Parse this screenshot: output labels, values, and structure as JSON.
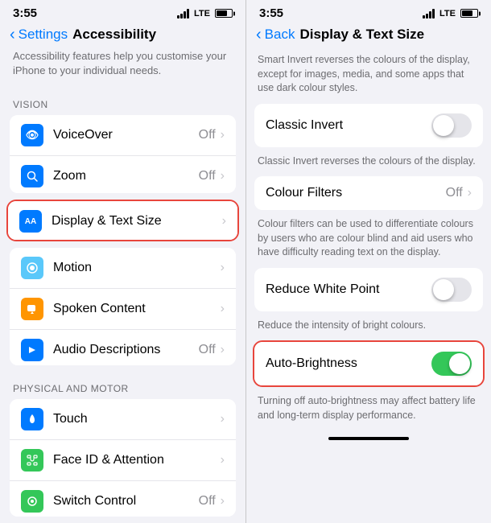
{
  "left": {
    "statusBar": {
      "time": "3:55",
      "lte": "LTE"
    },
    "nav": {
      "back": "Settings",
      "title": "Accessibility"
    },
    "description": "Accessibility features help you customise your iPhone to your individual needs.",
    "sections": [
      {
        "header": "VISION",
        "items": [
          {
            "label": "VoiceOver",
            "value": "Off",
            "hasChevron": true,
            "iconBg": "icon-voiceover",
            "iconSymbol": "👁",
            "id": "voiceover"
          },
          {
            "label": "Zoom",
            "value": "Off",
            "hasChevron": true,
            "iconBg": "icon-zoom",
            "iconSymbol": "⊕",
            "id": "zoom"
          },
          {
            "label": "Display & Text Size",
            "value": "",
            "hasChevron": true,
            "iconBg": "icon-display",
            "iconSymbol": "AA",
            "id": "display",
            "highlighted": true
          },
          {
            "label": "Motion",
            "value": "",
            "hasChevron": true,
            "iconBg": "icon-motion",
            "iconSymbol": "◎",
            "id": "motion"
          },
          {
            "label": "Spoken Content",
            "value": "",
            "hasChevron": true,
            "iconBg": "icon-spoken",
            "iconSymbol": "💬",
            "id": "spoken"
          },
          {
            "label": "Audio Descriptions",
            "value": "Off",
            "hasChevron": true,
            "iconBg": "icon-audio",
            "iconSymbol": "▶",
            "id": "audio"
          }
        ]
      },
      {
        "header": "PHYSICAL AND MOTOR",
        "items": [
          {
            "label": "Touch",
            "value": "",
            "hasChevron": true,
            "iconBg": "icon-touch",
            "iconSymbol": "✋",
            "id": "touch"
          },
          {
            "label": "Face ID & Attention",
            "value": "",
            "hasChevron": true,
            "iconBg": "icon-faceid",
            "iconSymbol": "😶",
            "id": "faceid"
          },
          {
            "label": "Switch Control",
            "value": "Off",
            "hasChevron": true,
            "iconBg": "icon-switch",
            "iconSymbol": "⊙",
            "id": "switch"
          }
        ]
      }
    ]
  },
  "right": {
    "statusBar": {
      "time": "3:55",
      "lte": "LTE"
    },
    "nav": {
      "back": "Back",
      "title": "Display & Text Size"
    },
    "introText": "Smart Invert reverses the colours of the display, except for images, media, and some apps that use dark colour styles.",
    "settings": [
      {
        "id": "classic-invert",
        "label": "Classic Invert",
        "type": "toggle",
        "value": false,
        "desc": "Classic Invert reverses the colours of the display."
      },
      {
        "id": "colour-filters",
        "label": "Colour Filters",
        "type": "value",
        "value": "Off",
        "hasChevron": true,
        "desc": "Colour filters can be used to differentiate colours by users who are colour blind and aid users who have difficulty reading text on the display."
      },
      {
        "id": "reduce-white-point",
        "label": "Reduce White Point",
        "type": "toggle",
        "value": false,
        "desc": "Reduce the intensity of bright colours."
      },
      {
        "id": "auto-brightness",
        "label": "Auto-Brightness",
        "type": "toggle",
        "value": true,
        "highlighted": true,
        "desc": "Turning off auto-brightness may affect battery life and long-term display performance."
      }
    ]
  }
}
